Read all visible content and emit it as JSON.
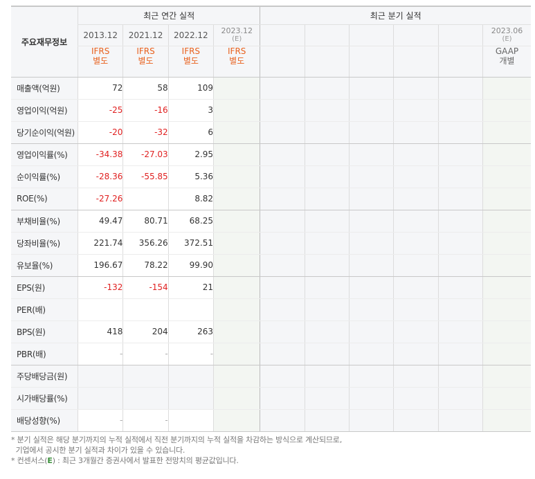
{
  "header": {
    "metric_title": "주요재무정보",
    "annual_group": "최근 연간 실적",
    "quarter_group": "최근 분기 실적",
    "annual_years": [
      "2013.12",
      "2021.12",
      "2022.12"
    ],
    "annual_est_year": "2023.12",
    "annual_est_mark": "(E)",
    "annual_standards": [
      [
        "IFRS",
        "별도"
      ],
      [
        "IFRS",
        "별도"
      ],
      [
        "IFRS",
        "별도"
      ]
    ],
    "annual_est_standard": [
      "IFRS",
      "별도"
    ],
    "quarter_last_year": "2023.06",
    "quarter_last_mark": "(E)",
    "quarter_last_standard": [
      "GAAP",
      "개별"
    ]
  },
  "rows": [
    {
      "label": "매출액(억원)",
      "values": [
        "72",
        "58",
        "109"
      ],
      "neg": [
        false,
        false,
        false
      ],
      "group_end": false
    },
    {
      "label": "영업이익(억원)",
      "values": [
        "-25",
        "-16",
        "3"
      ],
      "neg": [
        true,
        true,
        false
      ],
      "group_end": false
    },
    {
      "label": "당기순이익(억원)",
      "values": [
        "-20",
        "-32",
        "6"
      ],
      "neg": [
        true,
        true,
        false
      ],
      "group_end": true
    },
    {
      "label": "영업이익률(%)",
      "values": [
        "-34.38",
        "-27.03",
        "2.95"
      ],
      "neg": [
        true,
        true,
        false
      ],
      "group_end": false
    },
    {
      "label": "순이익률(%)",
      "values": [
        "-28.36",
        "-55.85",
        "5.36"
      ],
      "neg": [
        true,
        true,
        false
      ],
      "group_end": false
    },
    {
      "label": "ROE(%)",
      "values": [
        "-27.26",
        "",
        "8.82"
      ],
      "neg": [
        true,
        false,
        false
      ],
      "group_end": true
    },
    {
      "label": "부채비율(%)",
      "values": [
        "49.47",
        "80.71",
        "68.25"
      ],
      "neg": [
        false,
        false,
        false
      ],
      "group_end": false
    },
    {
      "label": "당좌비율(%)",
      "values": [
        "221.74",
        "356.26",
        "372.51"
      ],
      "neg": [
        false,
        false,
        false
      ],
      "group_end": false
    },
    {
      "label": "유보율(%)",
      "values": [
        "196.67",
        "78.22",
        "99.90"
      ],
      "neg": [
        false,
        false,
        false
      ],
      "group_end": true
    },
    {
      "label": "EPS(원)",
      "values": [
        "-132",
        "-154",
        "21"
      ],
      "neg": [
        true,
        true,
        false
      ],
      "group_end": false
    },
    {
      "label": "PER(배)",
      "values": [
        "",
        "",
        ""
      ],
      "neg": [
        false,
        false,
        false
      ],
      "group_end": false
    },
    {
      "label": "BPS(원)",
      "values": [
        "418",
        "204",
        "263"
      ],
      "neg": [
        false,
        false,
        false
      ],
      "group_end": false
    },
    {
      "label": "PBR(배)",
      "values": [
        "-",
        "-",
        "-"
      ],
      "neg": [
        false,
        false,
        false
      ],
      "group_end": true
    },
    {
      "label": "주당배당금(원)",
      "values": [
        "",
        "",
        ""
      ],
      "neg": [
        false,
        false,
        false
      ],
      "group_end": false,
      "gray": true
    },
    {
      "label": "시가배당률(%)",
      "values": [
        "",
        "",
        ""
      ],
      "neg": [
        false,
        false,
        false
      ],
      "group_end": false,
      "gray": true
    },
    {
      "label": "배당성향(%)",
      "values": [
        "-",
        "-",
        ""
      ],
      "neg": [
        false,
        false,
        false
      ],
      "group_end": true
    }
  ],
  "footnotes": {
    "line1": "* 분기 실적은 해당 분기까지의 누적 실적에서 직전 분기까지의 누적 실적을 차감하는 방식으로 계산되므로,",
    "line2": "  기업에서 공시한 분기 실적과 차이가 있을 수 있습니다.",
    "line3_prefix": "* 컨센서스(",
    "line3_mark": "E",
    "line3_suffix": ") : 최근 3개월간 증권사에서 발표한 전망치의 평균값입니다."
  },
  "colors": {
    "negative": "#e02020",
    "standard_accent": "#e8601c",
    "header_bg": "#f5f6f8",
    "estimate_bg": "#f3f6f2"
  }
}
